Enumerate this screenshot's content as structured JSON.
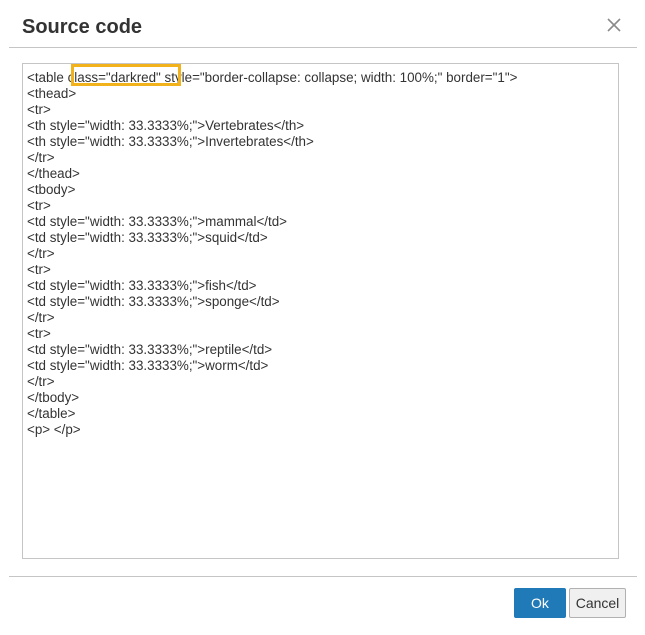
{
  "dialog": {
    "title": "Source code",
    "close_label": "×"
  },
  "editor": {
    "first_line_prefix": "<table ",
    "first_line_highlight": "class=\"darkred\"",
    "first_line_suffix": " style=\"border-collapse: collapse; width: 100%;\" border=\"1\">",
    "lines": [
      "<thead>",
      "<tr>",
      "<th style=\"width: 33.3333%;\">Vertebrates</th>",
      "<th style=\"width: 33.3333%;\">Invertebrates</th>",
      "</tr>",
      "</thead>",
      "<tbody>",
      "<tr>",
      "<td style=\"width: 33.3333%;\">mammal</td>",
      "<td style=\"width: 33.3333%;\">squid</td>",
      "</tr>",
      "<tr>",
      "<td style=\"width: 33.3333%;\">fish</td>",
      "<td style=\"width: 33.3333%;\">sponge</td>",
      "</tr>",
      "<tr>",
      "<td style=\"width: 33.3333%;\">reptile</td>",
      "<td style=\"width: 33.3333%;\">worm</td>",
      "</tr>",
      "</tbody>",
      "</table>",
      "<p> </p>"
    ],
    "highlight_color": "#f2b21b"
  },
  "footer": {
    "ok_label": "Ok",
    "cancel_label": "Cancel"
  },
  "colors": {
    "primary": "#207ab7",
    "text": "#333333",
    "border": "#c5c5c5"
  }
}
